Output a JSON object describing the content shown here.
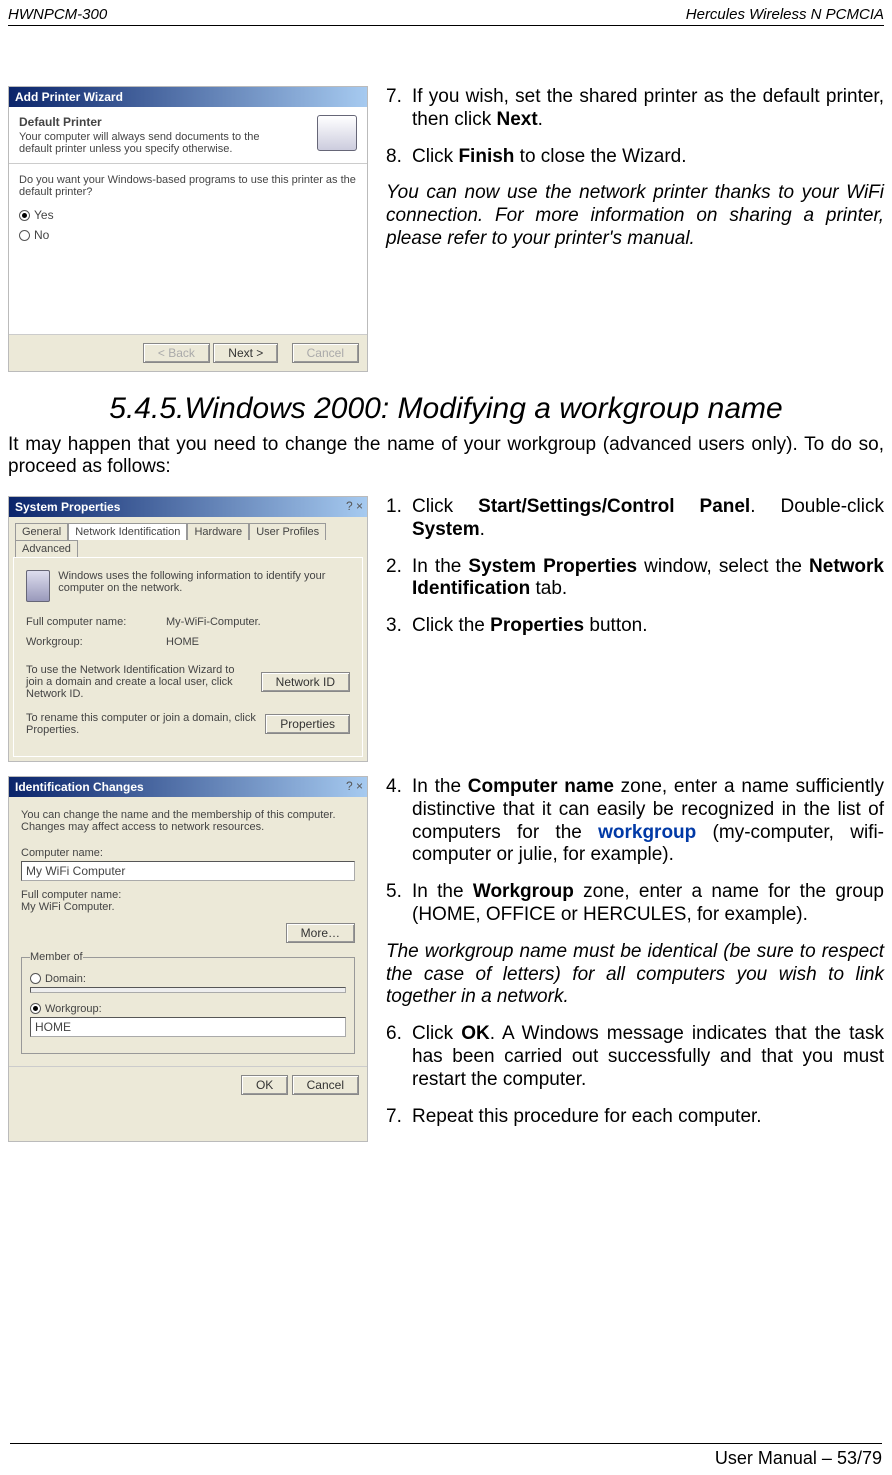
{
  "header": {
    "left": "HWNPCM-300",
    "right": "Hercules Wireless N PCMCIA"
  },
  "block1": {
    "wizard": {
      "title": "Add Printer Wizard",
      "heading": "Default Printer",
      "sub": "Your computer will always send documents to the default printer unless you specify otherwise.",
      "question": "Do you want your Windows-based programs to use this printer as the default printer?",
      "yes": "Yes",
      "no": "No",
      "back": "< Back",
      "next": "Next >",
      "cancel": "Cancel"
    },
    "steps": {
      "s7a": "If you wish, set the shared printer as the default printer, then click ",
      "s7b": "Next",
      "s7c": ".",
      "s8a": "Click ",
      "s8b": "Finish",
      "s8c": " to close the Wizard.",
      "ital": "You can now use the network printer thanks to your WiFi connection.  For more information on sharing a printer, please refer to your printer's manual."
    }
  },
  "section": {
    "num": "5.4.5.",
    "title": "Windows 2000: Modifying a workgroup name",
    "intro": "It may happen that you need to change the name of your workgroup (advanced users only).  To do so, proceed as follows:"
  },
  "block2": {
    "sysprops": {
      "title": "System Properties",
      "tabs": {
        "general": "General",
        "netid": "Network Identification",
        "hw": "Hardware",
        "up": "User Profiles",
        "adv": "Advanced"
      },
      "desc": "Windows uses the following information to identify your computer on the network.",
      "fcnLabel": "Full computer name:",
      "fcnVal": "My-WiFi-Computer.",
      "wgLabel": "Workgroup:",
      "wgVal": "HOME",
      "nid_desc": "To use the Network Identification Wizard to join a domain and create a local user, click Network ID.",
      "nid_btn": "Network ID",
      "prop_desc": "To rename this computer or join a domain, click Properties.",
      "prop_btn": "Properties"
    },
    "steps": {
      "s1a": "Click ",
      "s1b": "Start/Settings/Control Panel",
      "s1c": ".  Double-click ",
      "s1d": "System",
      "s1e": ".",
      "s2a": "In the ",
      "s2b": "System Properties",
      "s2c": " window, select the ",
      "s2d": "Network Identification",
      "s2e": " tab.",
      "s3a": "Click the ",
      "s3b": "Properties",
      "s3c": " button."
    }
  },
  "block3": {
    "idchg": {
      "title": "Identification Changes",
      "desc": "You can change the name and the membership of this computer. Changes may affect access to network resources.",
      "cnLabel": "Computer name:",
      "cnVal": "My WiFi Computer",
      "fcnLabel": "Full computer name:",
      "fcnVal": "My WiFi Computer.",
      "more": "More…",
      "member": "Member of",
      "domain": "Domain:",
      "workgroup": "Workgroup:",
      "wgVal": "HOME",
      "ok": "OK",
      "cancel": "Cancel"
    },
    "steps": {
      "s4a": "In the ",
      "s4b": "Computer name",
      "s4c": " zone, enter a name sufficiently distinctive that it can easily be recognized in the list of computers for the ",
      "s4d": "workgroup",
      "s4e": " (my-computer, wifi-computer or julie, for example).",
      "s5a": "In the ",
      "s5b": "Workgroup",
      "s5c": " zone, enter a name for the group (HOME, OFFICE or HERCULES, for example).",
      "ital": "The workgroup name must be identical (be sure to respect the case of letters) for all computers you wish to link together in a network.",
      "s6a": "Click ",
      "s6b": "OK",
      "s6c": ".  A Windows message indicates that the task has been carried out successfully and that you must restart the computer.",
      "s7": "Repeat this procedure for each computer."
    }
  },
  "footer": "User Manual – 53/79"
}
